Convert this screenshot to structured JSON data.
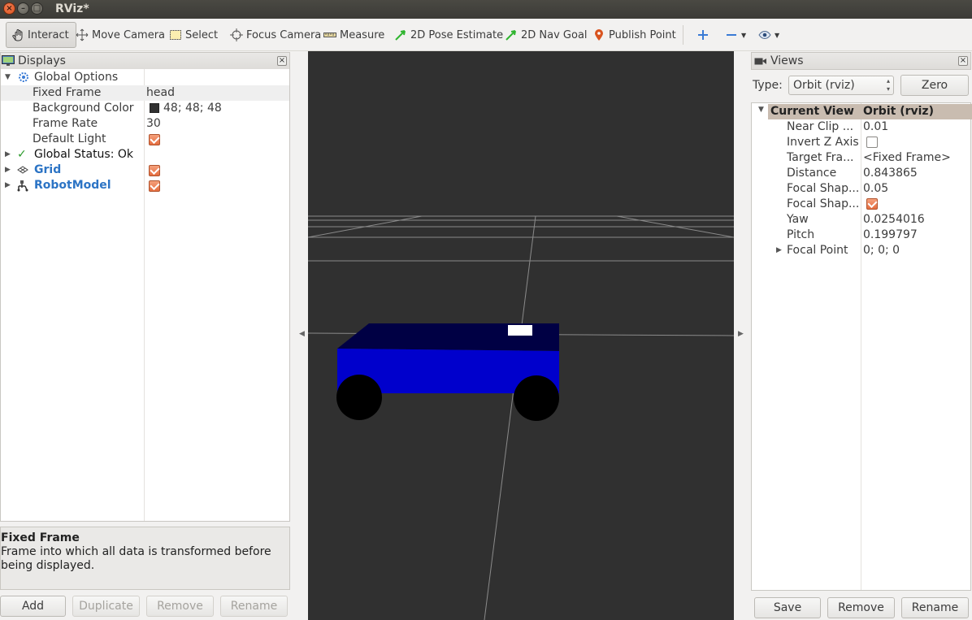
{
  "window": {
    "title": "RViz*"
  },
  "toolbar": {
    "tools": [
      {
        "label": "Interact"
      },
      {
        "label": "Move Camera"
      },
      {
        "label": "Select"
      },
      {
        "label": "Focus Camera"
      },
      {
        "label": "Measure"
      },
      {
        "label": "2D Pose Estimate"
      },
      {
        "label": "2D Nav Goal"
      },
      {
        "label": "Publish Point"
      }
    ]
  },
  "displays": {
    "title": "Displays",
    "rows": [
      {
        "label": "Global Options"
      },
      {
        "label": "Fixed Frame",
        "value": "head"
      },
      {
        "label": "Background Color",
        "value": "48; 48; 48"
      },
      {
        "label": "Frame Rate",
        "value": "30"
      },
      {
        "label": "Default Light"
      },
      {
        "label": "Global Status: Ok"
      },
      {
        "label": "Grid"
      },
      {
        "label": "RobotModel"
      }
    ],
    "description": {
      "title": "Fixed Frame",
      "text": "Frame into which all data is transformed before being displayed."
    },
    "buttons": {
      "add": "Add",
      "duplicate": "Duplicate",
      "remove": "Remove",
      "rename": "Rename"
    }
  },
  "views": {
    "title": "Views",
    "type_label": "Type:",
    "type_value": "Orbit (rviz)",
    "zero_label": "Zero",
    "header": {
      "label": "Current View",
      "value": "Orbit (rviz)"
    },
    "rows": [
      {
        "label": "Near Clip ...",
        "value": "0.01"
      },
      {
        "label": "Invert Z Axis",
        "value": ""
      },
      {
        "label": "Target Fra...",
        "value": "<Fixed Frame>"
      },
      {
        "label": "Distance",
        "value": "0.843865"
      },
      {
        "label": "Focal Shap...",
        "value": "0.05"
      },
      {
        "label": "Focal Shap...",
        "value": ""
      },
      {
        "label": "Yaw",
        "value": "0.0254016"
      },
      {
        "label": "Pitch",
        "value": "0.199797"
      },
      {
        "label": "Focal Point",
        "value": "0; 0; 0"
      }
    ],
    "buttons": {
      "save": "Save",
      "remove": "Remove",
      "rename": "Rename"
    }
  },
  "colors": {
    "viewport_bg": "#303030",
    "robot_body": "#0000cc",
    "robot_top": "#000044",
    "checkbox_accent": "#e56d3f",
    "link_blue": "#2c74c5"
  }
}
